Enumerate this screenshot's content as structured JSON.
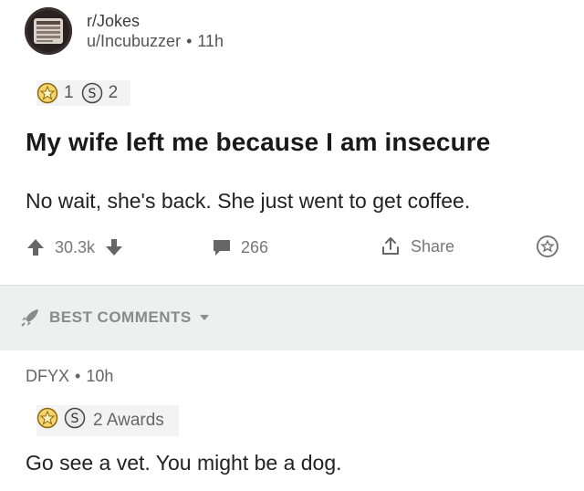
{
  "post": {
    "subreddit": "r/Jokes",
    "author": "u/Incubuzzer",
    "separator": "•",
    "age": "11h",
    "awards": [
      {
        "icon": "gold-award-icon",
        "count": "1"
      },
      {
        "icon": "silver-award-icon",
        "count": "2"
      }
    ],
    "title": "My wife left me because I am insecure",
    "body": "No wait, she's back. She just went to get coffee.",
    "score": "30.3k",
    "comment_count": "266",
    "share_label": "Share"
  },
  "sort": {
    "label": "BEST COMMENTS"
  },
  "comment": {
    "author": "DFYX",
    "separator": "•",
    "age": "10h",
    "awards_label": "2 Awards",
    "text": "Go see a vet. You might be a dog."
  },
  "colors": {
    "text": "#1a1a1b",
    "muted": "#777777",
    "band": "#eeefef",
    "gold": "#e8b931",
    "silver": "#8c8c8c"
  }
}
